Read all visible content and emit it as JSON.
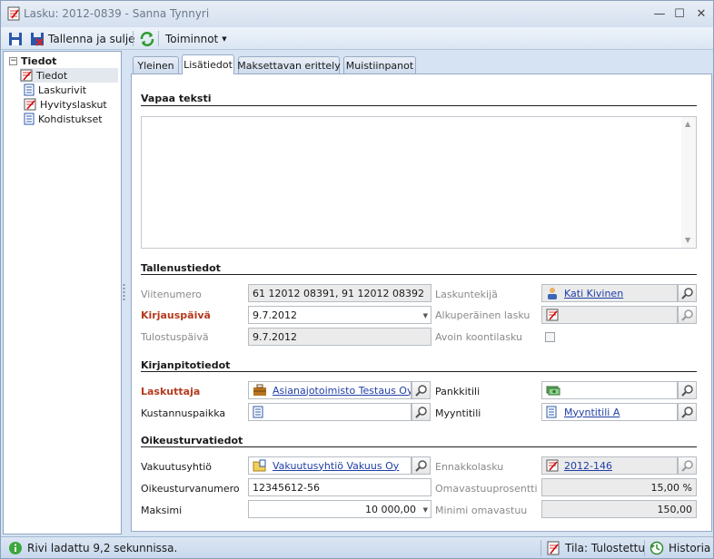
{
  "window": {
    "title": "Lasku: 2012-0839 - Sanna Tynnyri",
    "minimize": "—",
    "maximize": "☐",
    "close": "✕"
  },
  "toolbar": {
    "save_close_label": "Tallenna ja sulje",
    "actions_label": "Toiminnot"
  },
  "sidebar": {
    "root": "Tiedot",
    "items": [
      {
        "label": "Tiedot",
        "icon": "invoice-icon"
      },
      {
        "label": "Laskurivit",
        "icon": "document-icon"
      },
      {
        "label": "Hyvityslaskut",
        "icon": "invoice-icon"
      },
      {
        "label": "Kohdistukset",
        "icon": "document-icon"
      }
    ]
  },
  "tabs": [
    "Yleinen",
    "Lisätiedot",
    "Maksettavan erittely",
    "Muistiinpanot"
  ],
  "active_tab": "Lisätiedot",
  "form": {
    "free_text": {
      "heading": "Vapaa teksti",
      "value": ""
    },
    "storage": {
      "heading": "Tallenustiedot",
      "reference_label": "Viitenumero",
      "reference_value": "61 12012 08391, 91 12012 08392",
      "booking_date_label": "Kirjauspäivä",
      "booking_date_value": "9.7.2012",
      "print_date_label": "Tulostuspäivä",
      "print_date_value": "9.7.2012",
      "invoicer_label": "Laskuntekijä",
      "invoicer_value": "Kati Kivinen",
      "original_invoice_label": "Alkuperäinen lasku",
      "original_invoice_value": "",
      "open_summary_label": "Avoin koontilasku",
      "open_summary_checked": false
    },
    "accounting": {
      "heading": "Kirjanpitotiedot",
      "biller_label": "Laskuttaja",
      "biller_value": "Asianajotoimisto Testaus Oy Ab",
      "cost_center_label": "Kustannuspaikka",
      "cost_center_value": "",
      "bank_account_label": "Pankkitili",
      "bank_account_value": "",
      "sales_account_label": "Myyntitili",
      "sales_account_value": "Myyntitili A"
    },
    "legal": {
      "heading": "Oikeusturvatiedot",
      "insurer_label": "Vakuutusyhtiö",
      "insurer_value": "Vakuutusyhtiö Vakuus Oy",
      "legal_number_label": "Oikeusturvanumero",
      "legal_number_value": "12345612-56",
      "maximum_label": "Maksimi",
      "maximum_value": "10 000,00",
      "advance_invoice_label": "Ennakkolasku",
      "advance_invoice_value": "2012-146",
      "deductible_pct_label": "Omavastuuprosentti",
      "deductible_pct_value": "15,00 %",
      "min_deductible_label": "Minimi omavastuu",
      "min_deductible_value": "150,00"
    }
  },
  "status": {
    "message": "Rivi ladattu 9,2 sekunnissa.",
    "state": "Tila: Tulostettu",
    "history": "Historia"
  },
  "colors": {
    "accent": "#1f3ea6",
    "required_label": "#b53a1e",
    "chrome": "#d6e3f2"
  }
}
